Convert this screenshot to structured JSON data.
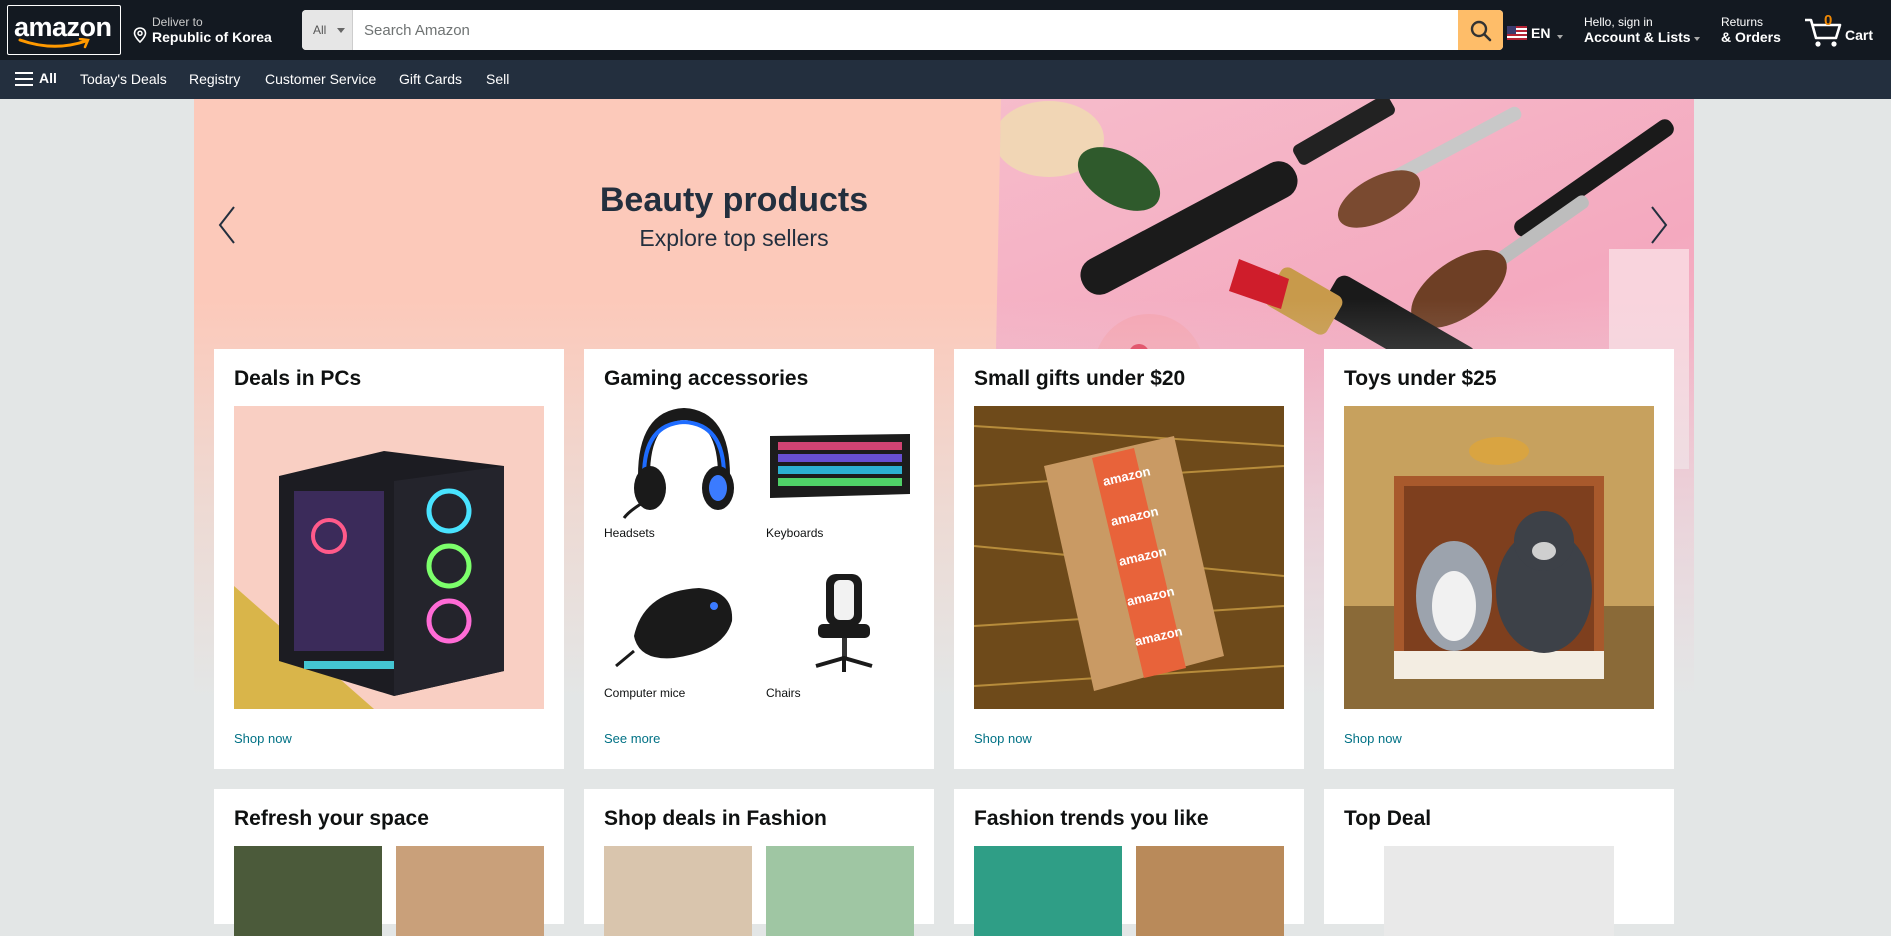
{
  "header": {
    "logo_text": "amazon",
    "deliver": {
      "line1": "Deliver to",
      "line2": "Republic of Korea"
    },
    "search": {
      "department": "All",
      "placeholder": "Search Amazon"
    },
    "language": {
      "code": "EN"
    },
    "account": {
      "line1": "Hello, sign in",
      "line2": "Account & Lists"
    },
    "returns": {
      "line1": "Returns",
      "line2": "& Orders"
    },
    "cart": {
      "count": "0",
      "label": "Cart"
    }
  },
  "subnav": {
    "all_label": "All",
    "items": [
      "Today's Deals",
      "Registry",
      "Customer Service",
      "Gift Cards",
      "Sell"
    ]
  },
  "hero": {
    "title": "Beauty products",
    "subtitle": "Explore top sellers"
  },
  "cards_row1": [
    {
      "title": "Deals in PCs",
      "link": "Shop now"
    },
    {
      "title": "Gaming accessories",
      "link": "See more",
      "items": [
        "Headsets",
        "Keyboards",
        "Computer mice",
        "Chairs"
      ]
    },
    {
      "title": "Small gifts under $20",
      "link": "Shop now"
    },
    {
      "title": "Toys under $25",
      "link": "Shop now"
    }
  ],
  "cards_row2": [
    {
      "title": "Refresh your space"
    },
    {
      "title": "Shop deals in Fashion"
    },
    {
      "title": "Fashion trends you like"
    },
    {
      "title": "Top Deal"
    }
  ],
  "colors": {
    "nav_dark": "#131921",
    "nav_sub": "#232f3e",
    "search_button": "#febd69",
    "link": "#007185",
    "cart_count": "#f08804",
    "hero_bg": "#fcc9ba"
  }
}
